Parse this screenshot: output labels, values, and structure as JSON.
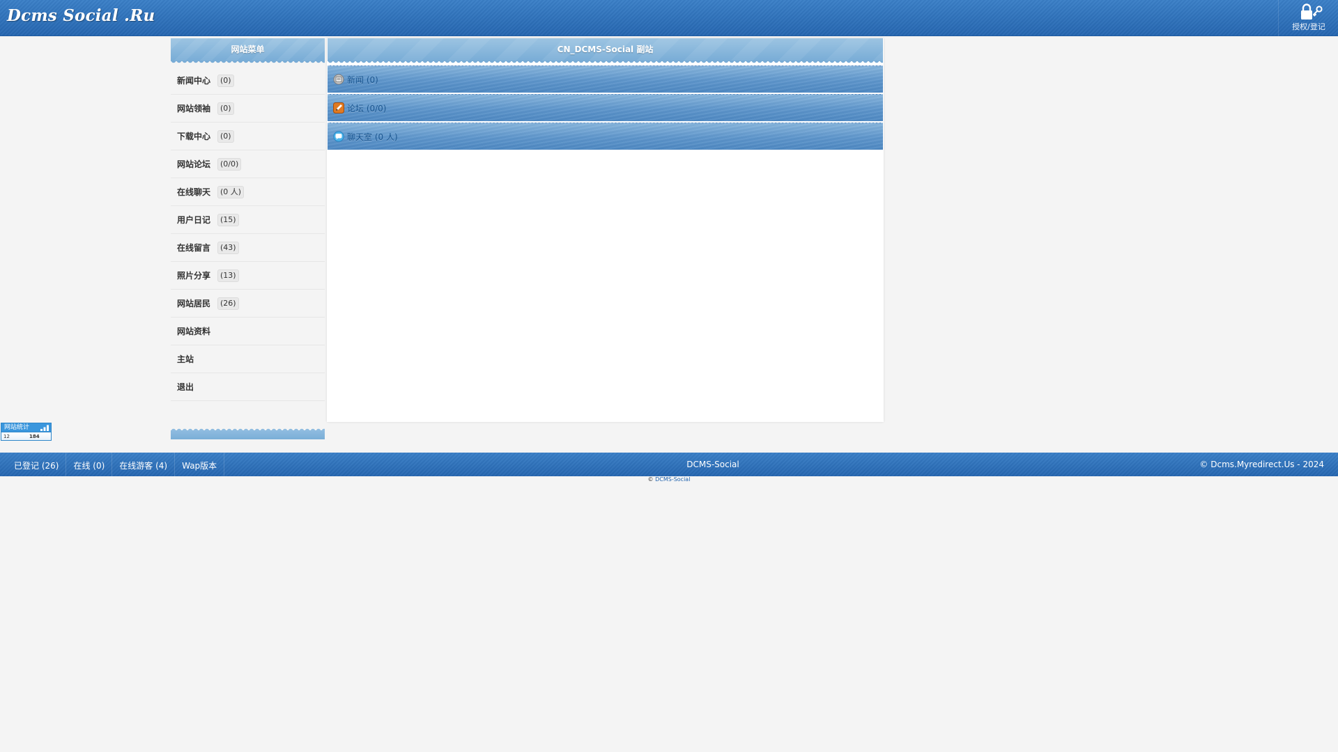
{
  "header": {
    "logo": "Dcms Social .Ru",
    "auth_label": "授权/登记",
    "auth_icon": "lock-key-icon"
  },
  "sidebar": {
    "title": "网站菜单",
    "items": [
      {
        "label": "新闻中心",
        "badge": "(0)"
      },
      {
        "label": "网站领袖",
        "badge": "(0)"
      },
      {
        "label": "下载中心",
        "badge": "(0)"
      },
      {
        "label": "网站论坛",
        "badge": "(0/0)"
      },
      {
        "label": "在线聊天",
        "badge": "(0 人)"
      },
      {
        "label": "用户日记",
        "badge": "(15)"
      },
      {
        "label": "在线留言",
        "badge": "(43)"
      },
      {
        "label": "照片分享",
        "badge": "(13)"
      },
      {
        "label": "网站居民",
        "badge": "(26)"
      },
      {
        "label": "网站资料"
      },
      {
        "label": "主站"
      },
      {
        "label": "退出"
      }
    ]
  },
  "main": {
    "title": "CN_DCMS-Social 副站",
    "links": [
      {
        "label": "新闻 (0)",
        "icon": "news-icon"
      },
      {
        "label": "论坛 (0/0)",
        "icon": "pencil-icon"
      },
      {
        "label": "聊天室 (0 人)",
        "icon": "chat-bubble-icon"
      }
    ]
  },
  "counter": {
    "title": "网站统计",
    "left_value": "12",
    "right_value": "184"
  },
  "footer": {
    "links": [
      "已登记 (26)",
      "在线 (0)",
      "在线游客 (4)",
      "Wap版本"
    ],
    "center": "DCMS-Social",
    "right": "© Dcms.Myredirect.Us - 2024",
    "credit_prefix": "©",
    "credit_link": "DCMS-Social"
  },
  "colors": {
    "header_bg": "#2b6db5",
    "panel_title_bg": "#88b6dc",
    "link_row_bg": "#5d95cb",
    "link_text": "#17548f",
    "page_bg": "#f4f4f4"
  }
}
